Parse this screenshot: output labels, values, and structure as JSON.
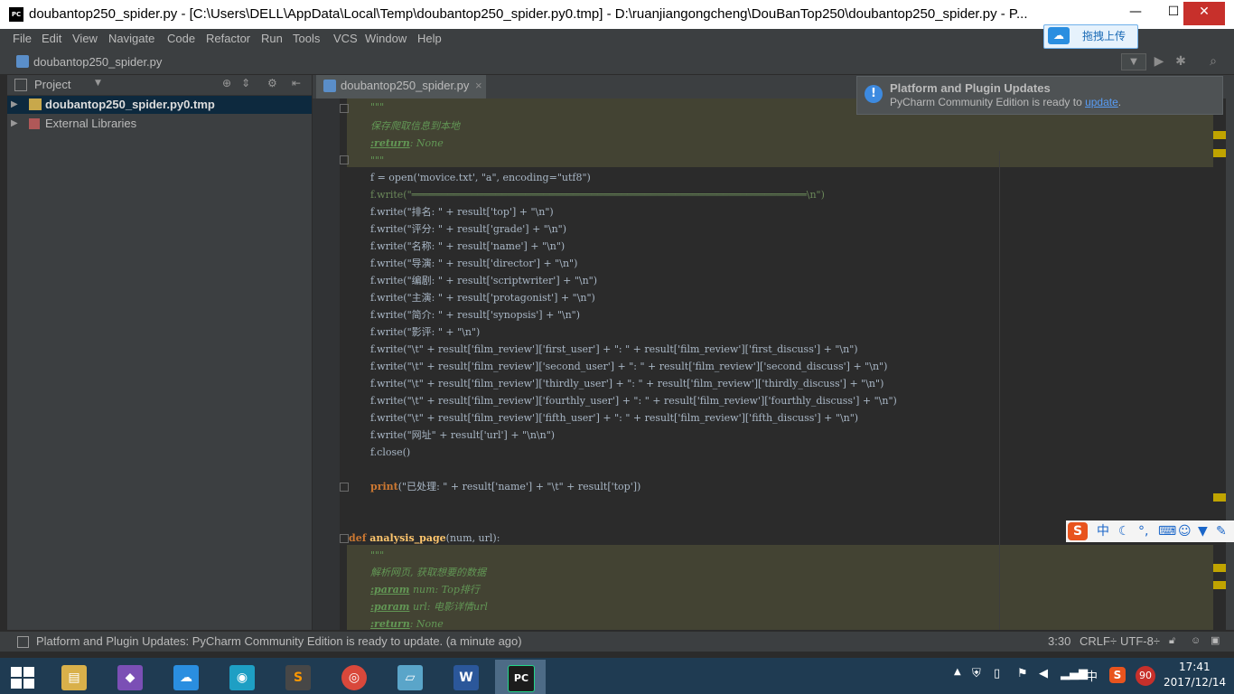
{
  "window": {
    "title": "doubantop250_spider.py - [C:\\Users\\DELL\\AppData\\Local\\Temp\\doubantop250_spider.py0.tmp] - D:\\ruanjiangongcheng\\DouBanTop250\\doubantop250_spider.py - P...",
    "app_badge": "PC",
    "minimize": "—",
    "maximize": "☐",
    "close": "✕"
  },
  "menu": [
    "File",
    "Edit",
    "View",
    "Navigate",
    "Code",
    "Refactor",
    "Run",
    "Tools",
    "VCS",
    "Window",
    "Help"
  ],
  "upload_button": "拖拽上传",
  "nav": {
    "breadcrumb": "doubantop250_spider.py"
  },
  "project": {
    "title": "Project",
    "items": [
      {
        "label": "doubantop250_spider.py0.tmp",
        "selected": true
      },
      {
        "label": "External Libraries",
        "selected": false
      }
    ]
  },
  "editor_tab": {
    "label": "doubantop250_spider.py",
    "close": "×"
  },
  "notification": {
    "title": "Platform and Plugin Updates",
    "body": "PyCharm Community Edition is ready to ",
    "link": "update",
    "tail": "."
  },
  "code": {
    "l1": "\"\"\"",
    "l2": "保存爬取信息到本地",
    "l3_tag": ":return",
    "l3_rest": ": None",
    "l4": "\"\"\"",
    "l5": "f = open('movice.txt', \"a\", encoding=\"utf8\")",
    "l6": "f.write(\"══════════════════════════════════════════════════════════════════\\n\")",
    "l7": "f.write(\"排名: \" + result['top'] + \"\\n\")",
    "l8": "f.write(\"评分: \" + result['grade'] + \"\\n\")",
    "l9": "f.write(\"名称: \" + result['name'] + \"\\n\")",
    "l10": "f.write(\"导演: \" + result['director'] + \"\\n\")",
    "l11": "f.write(\"编剧: \" + result['scriptwriter'] + \"\\n\")",
    "l12": "f.write(\"主演: \" + result['protagonist'] + \"\\n\")",
    "l13": "f.write(\"简介: \" + result['synopsis'] + \"\\n\")",
    "l14": "f.write(\"影评: \" + \"\\n\")",
    "l15": "f.write(\"\\t\" + result['film_review']['first_user'] + \": \" + result['film_review']['first_discuss'] + \"\\n\")",
    "l16": "f.write(\"\\t\" + result['film_review']['second_user'] + \": \" + result['film_review']['second_discuss'] + \"\\n\")",
    "l17": "f.write(\"\\t\" + result['film_review']['thirdly_user'] + \": \" + result['film_review']['thirdly_discuss'] + \"\\n\")",
    "l18": "f.write(\"\\t\" + result['film_review']['fourthly_user'] + \": \" + result['film_review']['fourthly_discuss'] + \"\\n\")",
    "l19": "f.write(\"\\t\" + result['film_review']['fifth_user'] + \": \" + result['film_review']['fifth_discuss'] + \"\\n\")",
    "l20": "f.write(\"网址\" + result['url'] + \"\\n\\n\")",
    "l21": "f.close()",
    "l22_kw": "print",
    "l22_rest": "(\"已处理: \" + result['name'] + \"\\t\" + result['top'])",
    "l23_kw": "def ",
    "l23_fn": "analysis_page",
    "l23_rest": "(num, url):",
    "l24": "\"\"\"",
    "l25": "解析网页, 获取想要的数据",
    "l26_tag": ":param",
    "l26_rest": " num: Top排行",
    "l27_tag": ":param",
    "l27_rest": " url: 电影详情url",
    "l28_tag": ":return",
    "l28_rest": ": None"
  },
  "status": {
    "message": "Platform and Plugin Updates: PyCharm Community Edition is ready to update. (a minute ago)",
    "position": "3:30",
    "line_sep": "CRLF÷",
    "encoding": "UTF-8÷"
  },
  "ime": {
    "brand": "S",
    "mode": "中"
  },
  "taskbar": {
    "apps": [
      {
        "name": "file-explorer",
        "glyph": "▤",
        "color": "#d9b04a"
      },
      {
        "name": "visual-studio",
        "glyph": "◆",
        "color": "#7b4fb5"
      },
      {
        "name": "baidu-netdisk",
        "glyph": "☁",
        "color": "#2a8ee0"
      },
      {
        "name": "media-player",
        "glyph": "◉",
        "color": "#1e9fc4"
      },
      {
        "name": "sublime-text",
        "glyph": "S",
        "color": "#474747"
      },
      {
        "name": "chrome",
        "glyph": "◎",
        "color": "#d9483b"
      },
      {
        "name": "notes",
        "glyph": "▱",
        "color": "#5aa5c9"
      },
      {
        "name": "word",
        "glyph": "W",
        "color": "#2b579a"
      },
      {
        "name": "pycharm",
        "glyph": "PC",
        "color": "#1c1c1c"
      }
    ],
    "time": "17:41",
    "date": "2017/12/14",
    "battery_badge": "90",
    "ime_tray": "中"
  }
}
